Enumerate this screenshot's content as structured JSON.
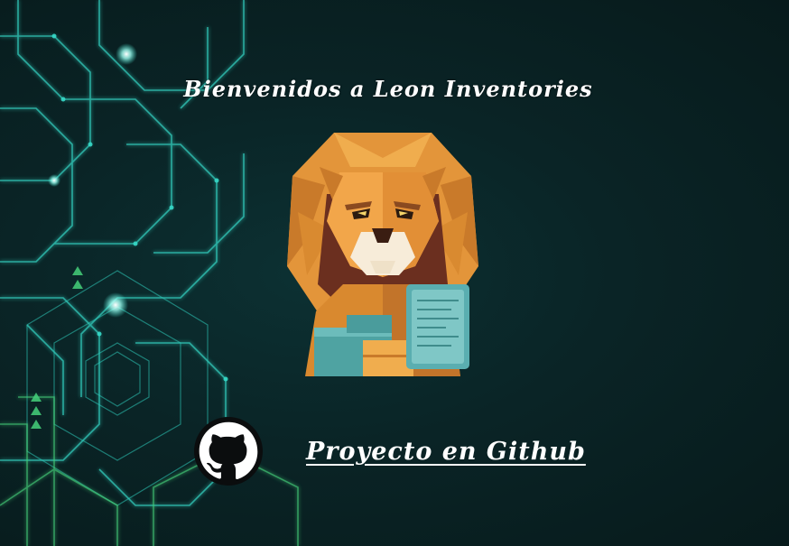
{
  "page": {
    "title": "Bienvenidos a Leon Inventories",
    "github_link_label": "Proyecto en Github"
  },
  "icons": {
    "logo": "lion-inventory-logo",
    "github": "github-octocat-icon"
  },
  "colors": {
    "background": "#0a2426",
    "circuit_glow": "#3ee6d2",
    "circuit_green": "#45d07a",
    "lion_orange": "#e89a3c",
    "lion_dark": "#6b2f1f",
    "box_teal": "#4a9c9c",
    "text": "#ffffff"
  }
}
